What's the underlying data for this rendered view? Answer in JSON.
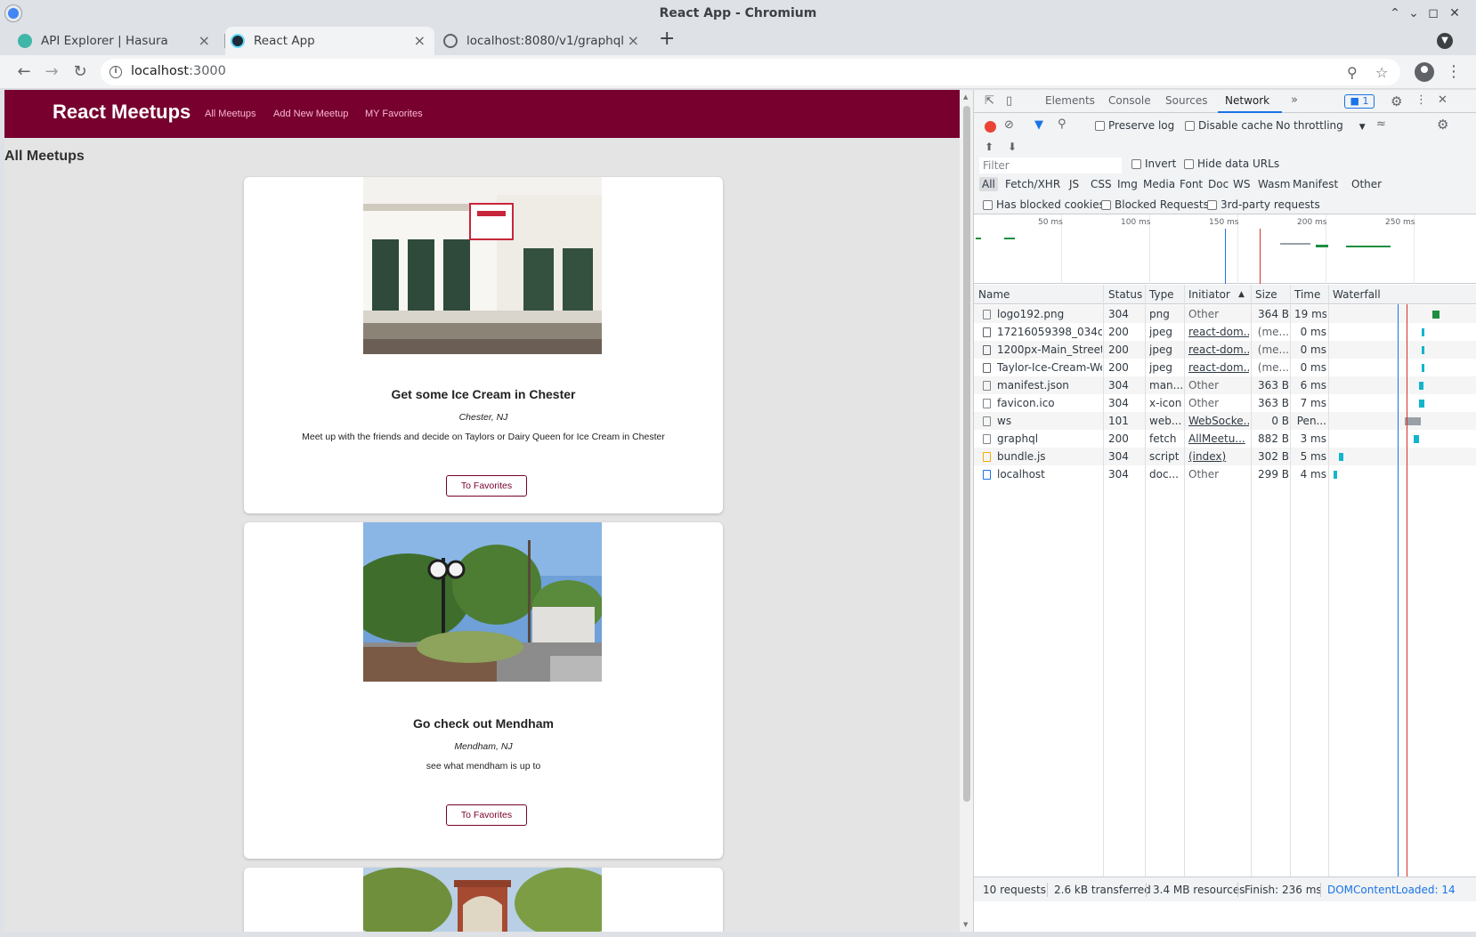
{
  "window": {
    "title": "React App - Chromium"
  },
  "tabs": [
    {
      "label": "API Explorer | Hasura",
      "icon": "hasura-icon"
    },
    {
      "label": "React App",
      "icon": "react-icon"
    },
    {
      "label": "localhost:8080/v1/graphql",
      "icon": "globe-icon"
    }
  ],
  "address": {
    "host": "localhost",
    "port": ":3000"
  },
  "app": {
    "logo": "React Meetups",
    "nav": [
      "All Meetups",
      "Add New Meetup",
      "MY Favorites"
    ],
    "heading": "All Meetups",
    "meetups": [
      {
        "title": "Get some Ice Cream in Chester",
        "address": "Chester, NJ",
        "description": "Meet up with the friends and decide on Taylors or Dairy Queen for Ice Cream in Chester",
        "button": "To Favorites"
      },
      {
        "title": "Go check out Mendham",
        "address": "Mendham, NJ",
        "description": "see what mendham is up to",
        "button": "To Favorites"
      }
    ]
  },
  "devtools": {
    "tabs": [
      "Elements",
      "Console",
      "Sources",
      "Network"
    ],
    "issues": "1",
    "preserve_log": "Preserve log",
    "disable_cache": "Disable cache",
    "throttling": "No throttling",
    "filter_placeholder": "Filter",
    "invert": "Invert",
    "hide_data_urls": "Hide data URLs",
    "types": [
      "All",
      "Fetch/XHR",
      "JS",
      "CSS",
      "Img",
      "Media",
      "Font",
      "Doc",
      "WS",
      "Wasm",
      "Manifest",
      "Other"
    ],
    "has_blocked_cookies": "Has blocked cookies",
    "blocked_requests": "Blocked Requests",
    "third_party": "3rd-party requests",
    "timeline_ticks": [
      "50 ms",
      "100 ms",
      "150 ms",
      "200 ms",
      "250 ms"
    ],
    "columns": [
      "Name",
      "Status",
      "Type",
      "Initiator",
      "Size",
      "Time",
      "Waterfall"
    ],
    "requests": [
      {
        "name": "logo192.png",
        "status": "304",
        "type": "png",
        "initiator": "Other",
        "size": "364 B",
        "time": "19 ms",
        "link": false
      },
      {
        "name": "17216059398_034c1...",
        "status": "200",
        "type": "jpeg",
        "initiator": "react-dom...",
        "size": "(me...",
        "time": "0 ms",
        "link": true
      },
      {
        "name": "1200px-Main_Street...",
        "status": "200",
        "type": "jpeg",
        "initiator": "react-dom...",
        "size": "(me...",
        "time": "0 ms",
        "link": true
      },
      {
        "name": "Taylor-Ice-Cream-We...",
        "status": "200",
        "type": "jpeg",
        "initiator": "react-dom...",
        "size": "(me...",
        "time": "0 ms",
        "link": true
      },
      {
        "name": "manifest.json",
        "status": "304",
        "type": "man...",
        "initiator": "Other",
        "size": "363 B",
        "time": "6 ms",
        "link": false
      },
      {
        "name": "favicon.ico",
        "status": "304",
        "type": "x-icon",
        "initiator": "Other",
        "size": "363 B",
        "time": "7 ms",
        "link": false
      },
      {
        "name": "ws",
        "status": "101",
        "type": "web...",
        "initiator": "WebSocke...",
        "size": "0 B",
        "time": "Pen...",
        "link": true
      },
      {
        "name": "graphql",
        "status": "200",
        "type": "fetch",
        "initiator": "AllMeetu...",
        "size": "882 B",
        "time": "3 ms",
        "link": true
      },
      {
        "name": "bundle.js",
        "status": "304",
        "type": "script",
        "initiator": "(index)",
        "size": "302 B",
        "time": "5 ms",
        "link": true
      },
      {
        "name": "localhost",
        "status": "304",
        "type": "doc...",
        "initiator": "Other",
        "size": "299 B",
        "time": "4 ms",
        "link": false
      }
    ],
    "summary": {
      "requests": "10 requests",
      "transferred": "2.6 kB transferred",
      "resources": "3.4 MB resources",
      "finish": "Finish: 236 ms",
      "dcl": "DOMContentLoaded: 14"
    }
  }
}
